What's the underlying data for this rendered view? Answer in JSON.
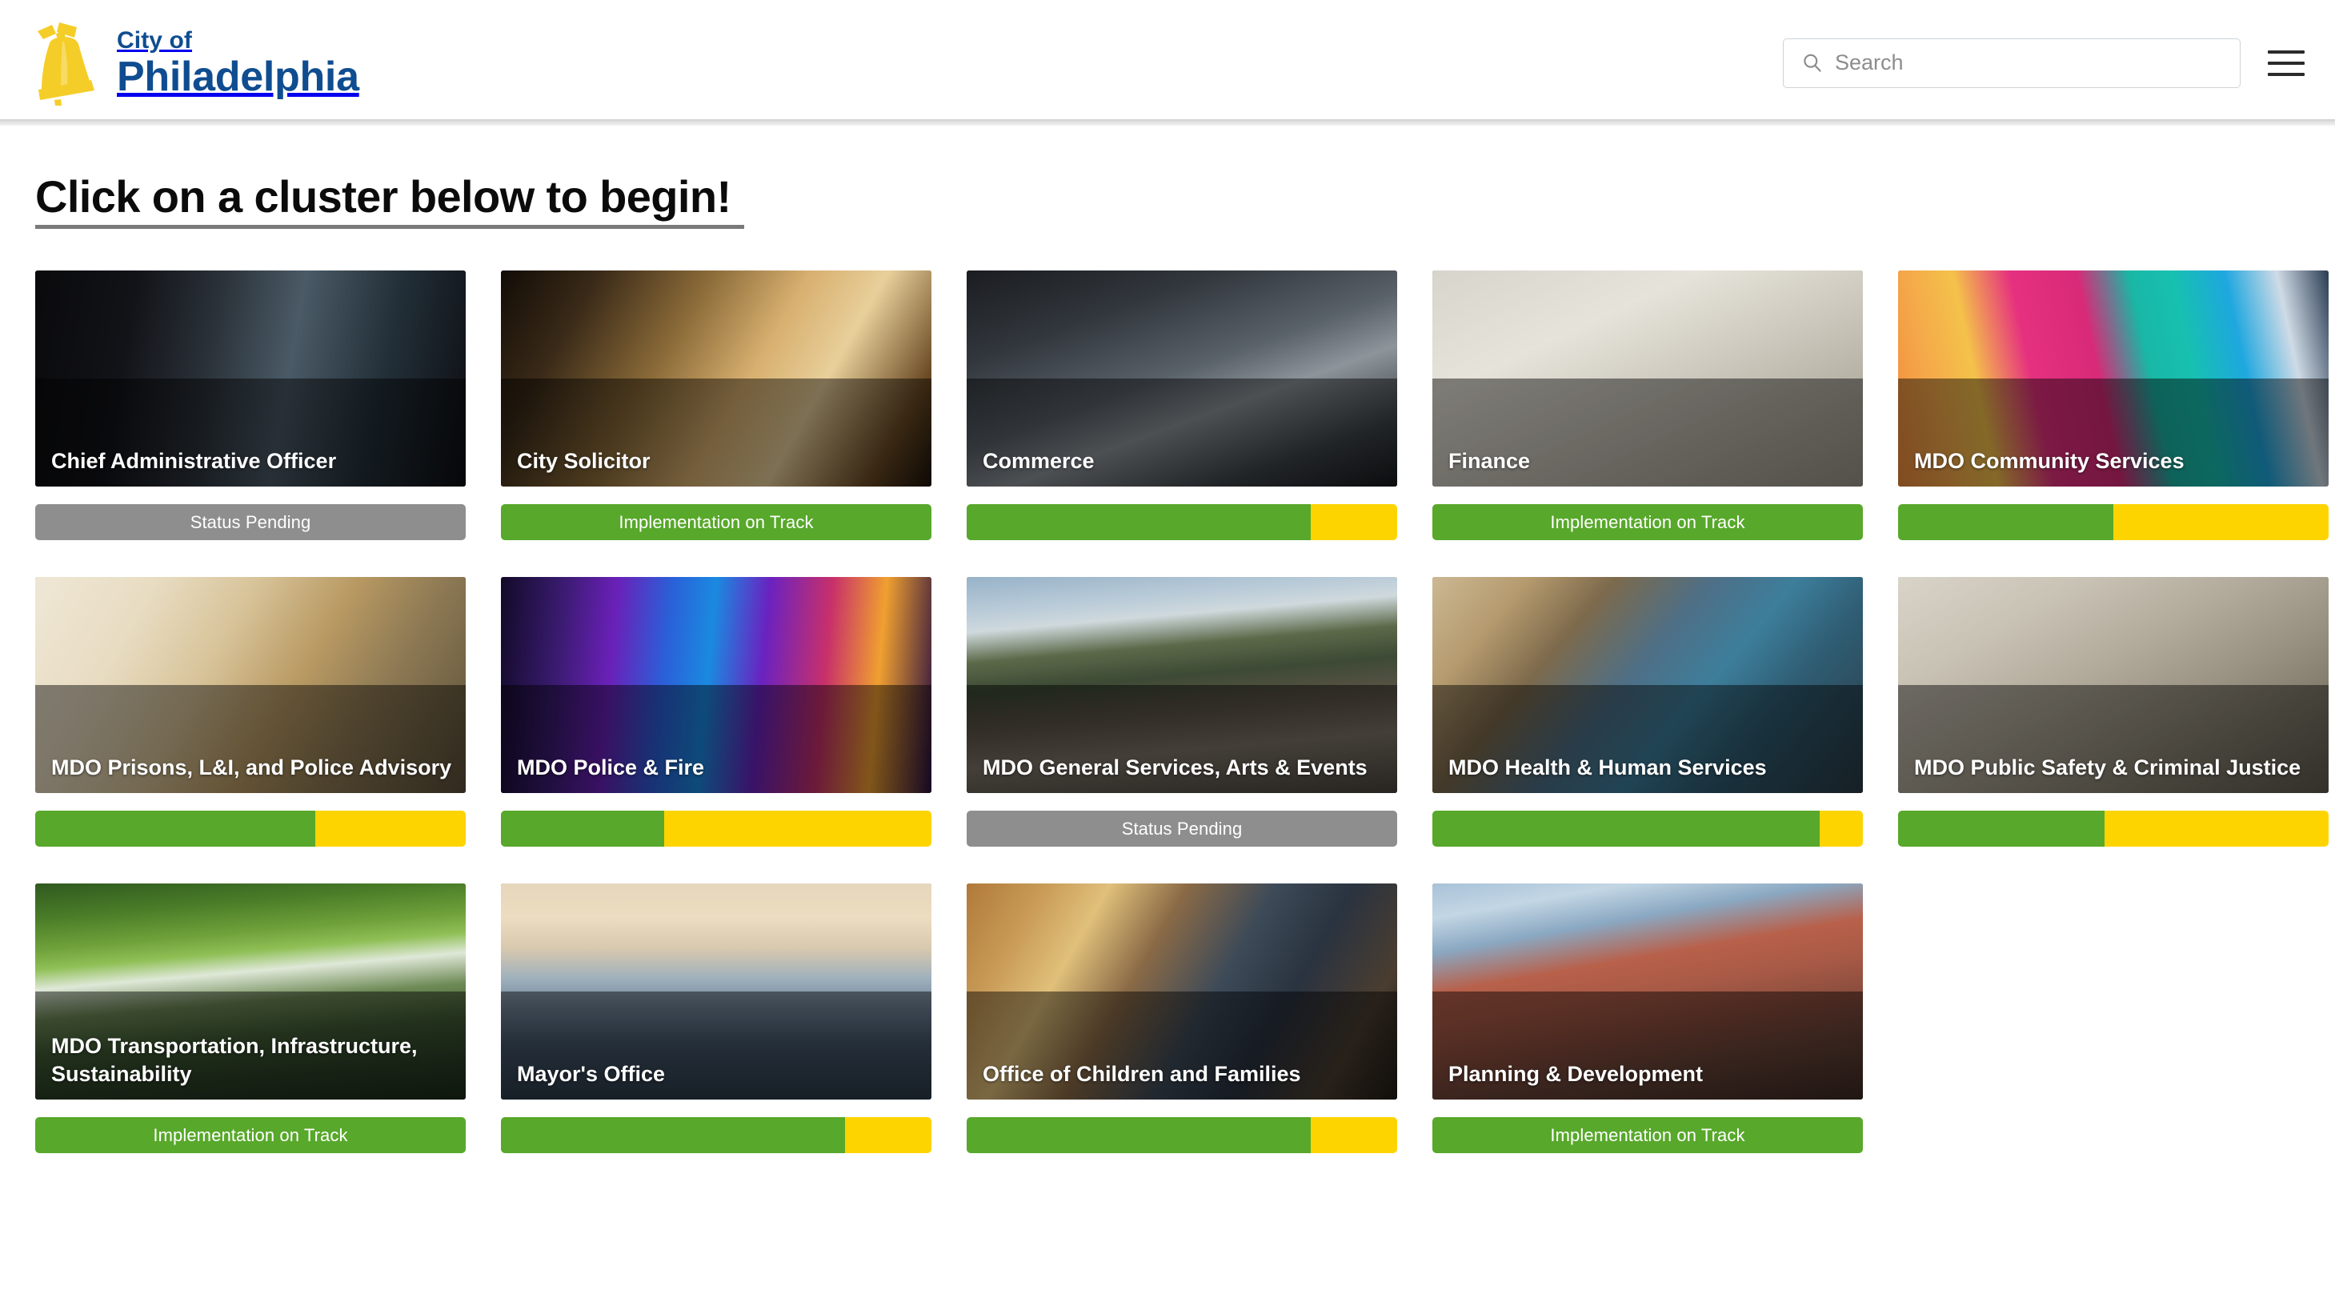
{
  "header": {
    "brand_city": "City of",
    "brand_name": "Philadelphia",
    "logo_icon": "liberty-bell-icon",
    "search": {
      "icon": "search-icon",
      "placeholder": "Search",
      "value": ""
    },
    "menu_icon": "hamburger-menu-icon"
  },
  "main": {
    "heading": "Click on a cluster below to begin!",
    "colors": {
      "green": "#58a82b",
      "yellow": "#fdd400",
      "gray": "#8e8e8e",
      "brand_blue": "#0f4d90",
      "brand_yellow": "#f5cd28"
    },
    "status_labels": {
      "on_track": "Implementation on Track",
      "pending": "Status Pending"
    },
    "clusters": [
      {
        "title": "Chief Administrative Officer",
        "art": "art-cabinet",
        "status": "pending",
        "label": "Status Pending",
        "green_pct": 0,
        "yellow_pct": 0
      },
      {
        "title": "City Solicitor",
        "art": "art-gavel",
        "status": "on_track",
        "label": "Implementation on Track",
        "green_pct": 100,
        "yellow_pct": 0
      },
      {
        "title": "Commerce",
        "art": "art-open",
        "status": "split",
        "label": "",
        "green_pct": 80,
        "yellow_pct": 20
      },
      {
        "title": "Finance",
        "art": "art-finance",
        "status": "on_track",
        "label": "Implementation on Track",
        "green_pct": 100,
        "yellow_pct": 0
      },
      {
        "title": "MDO Community Services",
        "art": "art-paint",
        "status": "split",
        "label": "",
        "green_pct": 50,
        "yellow_pct": 50
      },
      {
        "title": "MDO Prisons, L&I, and Police Advisory",
        "art": "art-clipboard",
        "status": "split",
        "label": "",
        "green_pct": 65,
        "yellow_pct": 35
      },
      {
        "title": "MDO Police & Fire",
        "art": "art-police",
        "status": "split",
        "label": "",
        "green_pct": 38,
        "yellow_pct": 62
      },
      {
        "title": "MDO General Services, Arts & Events",
        "art": "art-market",
        "status": "pending",
        "label": "Status Pending",
        "green_pct": 0,
        "yellow_pct": 0
      },
      {
        "title": "MDO Health & Human Services",
        "art": "art-health",
        "status": "split",
        "label": "",
        "green_pct": 90,
        "yellow_pct": 10
      },
      {
        "title": "MDO Public Safety & Criminal Justice",
        "art": "art-courthouse",
        "status": "split",
        "label": "",
        "green_pct": 48,
        "yellow_pct": 52
      },
      {
        "title": "MDO Transportation, Infrastructure, Sustainability",
        "art": "art-trees",
        "status": "on_track",
        "label": "Implementation on Track",
        "green_pct": 100,
        "yellow_pct": 0
      },
      {
        "title": "Mayor's Office",
        "art": "art-skyline",
        "status": "split",
        "label": "",
        "green_pct": 80,
        "yellow_pct": 20
      },
      {
        "title": "Office of Children and Families",
        "art": "art-kids",
        "status": "split",
        "label": "",
        "green_pct": 80,
        "yellow_pct": 20
      },
      {
        "title": "Planning & Development",
        "art": "art-rowhouse",
        "status": "on_track",
        "label": "Implementation on Track",
        "green_pct": 100,
        "yellow_pct": 0
      }
    ]
  }
}
